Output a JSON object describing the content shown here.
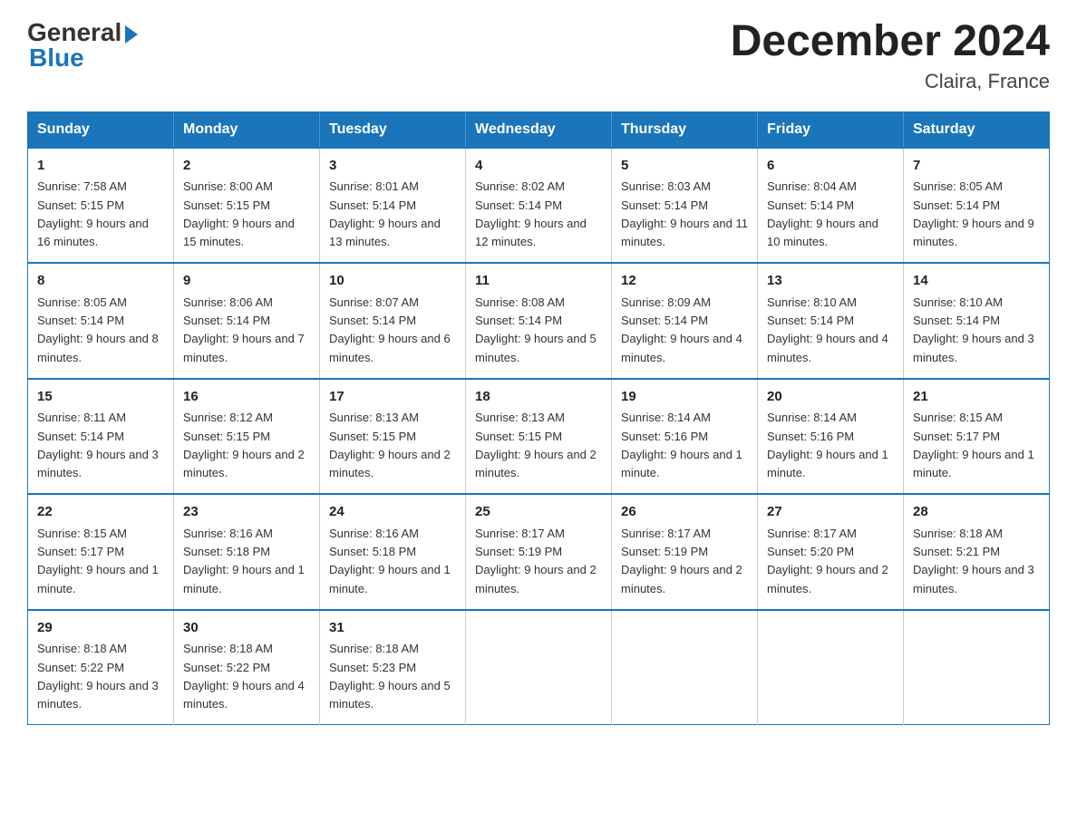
{
  "header": {
    "logo_general": "General",
    "logo_blue": "Blue",
    "month_year": "December 2024",
    "location": "Claira, France"
  },
  "days_of_week": [
    "Sunday",
    "Monday",
    "Tuesday",
    "Wednesday",
    "Thursday",
    "Friday",
    "Saturday"
  ],
  "weeks": [
    [
      {
        "num": "1",
        "sunrise": "7:58 AM",
        "sunset": "5:15 PM",
        "daylight": "9 hours and 16 minutes."
      },
      {
        "num": "2",
        "sunrise": "8:00 AM",
        "sunset": "5:15 PM",
        "daylight": "9 hours and 15 minutes."
      },
      {
        "num": "3",
        "sunrise": "8:01 AM",
        "sunset": "5:14 PM",
        "daylight": "9 hours and 13 minutes."
      },
      {
        "num": "4",
        "sunrise": "8:02 AM",
        "sunset": "5:14 PM",
        "daylight": "9 hours and 12 minutes."
      },
      {
        "num": "5",
        "sunrise": "8:03 AM",
        "sunset": "5:14 PM",
        "daylight": "9 hours and 11 minutes."
      },
      {
        "num": "6",
        "sunrise": "8:04 AM",
        "sunset": "5:14 PM",
        "daylight": "9 hours and 10 minutes."
      },
      {
        "num": "7",
        "sunrise": "8:05 AM",
        "sunset": "5:14 PM",
        "daylight": "9 hours and 9 minutes."
      }
    ],
    [
      {
        "num": "8",
        "sunrise": "8:05 AM",
        "sunset": "5:14 PM",
        "daylight": "9 hours and 8 minutes."
      },
      {
        "num": "9",
        "sunrise": "8:06 AM",
        "sunset": "5:14 PM",
        "daylight": "9 hours and 7 minutes."
      },
      {
        "num": "10",
        "sunrise": "8:07 AM",
        "sunset": "5:14 PM",
        "daylight": "9 hours and 6 minutes."
      },
      {
        "num": "11",
        "sunrise": "8:08 AM",
        "sunset": "5:14 PM",
        "daylight": "9 hours and 5 minutes."
      },
      {
        "num": "12",
        "sunrise": "8:09 AM",
        "sunset": "5:14 PM",
        "daylight": "9 hours and 4 minutes."
      },
      {
        "num": "13",
        "sunrise": "8:10 AM",
        "sunset": "5:14 PM",
        "daylight": "9 hours and 4 minutes."
      },
      {
        "num": "14",
        "sunrise": "8:10 AM",
        "sunset": "5:14 PM",
        "daylight": "9 hours and 3 minutes."
      }
    ],
    [
      {
        "num": "15",
        "sunrise": "8:11 AM",
        "sunset": "5:14 PM",
        "daylight": "9 hours and 3 minutes."
      },
      {
        "num": "16",
        "sunrise": "8:12 AM",
        "sunset": "5:15 PM",
        "daylight": "9 hours and 2 minutes."
      },
      {
        "num": "17",
        "sunrise": "8:13 AM",
        "sunset": "5:15 PM",
        "daylight": "9 hours and 2 minutes."
      },
      {
        "num": "18",
        "sunrise": "8:13 AM",
        "sunset": "5:15 PM",
        "daylight": "9 hours and 2 minutes."
      },
      {
        "num": "19",
        "sunrise": "8:14 AM",
        "sunset": "5:16 PM",
        "daylight": "9 hours and 1 minute."
      },
      {
        "num": "20",
        "sunrise": "8:14 AM",
        "sunset": "5:16 PM",
        "daylight": "9 hours and 1 minute."
      },
      {
        "num": "21",
        "sunrise": "8:15 AM",
        "sunset": "5:17 PM",
        "daylight": "9 hours and 1 minute."
      }
    ],
    [
      {
        "num": "22",
        "sunrise": "8:15 AM",
        "sunset": "5:17 PM",
        "daylight": "9 hours and 1 minute."
      },
      {
        "num": "23",
        "sunrise": "8:16 AM",
        "sunset": "5:18 PM",
        "daylight": "9 hours and 1 minute."
      },
      {
        "num": "24",
        "sunrise": "8:16 AM",
        "sunset": "5:18 PM",
        "daylight": "9 hours and 1 minute."
      },
      {
        "num": "25",
        "sunrise": "8:17 AM",
        "sunset": "5:19 PM",
        "daylight": "9 hours and 2 minutes."
      },
      {
        "num": "26",
        "sunrise": "8:17 AM",
        "sunset": "5:19 PM",
        "daylight": "9 hours and 2 minutes."
      },
      {
        "num": "27",
        "sunrise": "8:17 AM",
        "sunset": "5:20 PM",
        "daylight": "9 hours and 2 minutes."
      },
      {
        "num": "28",
        "sunrise": "8:18 AM",
        "sunset": "5:21 PM",
        "daylight": "9 hours and 3 minutes."
      }
    ],
    [
      {
        "num": "29",
        "sunrise": "8:18 AM",
        "sunset": "5:22 PM",
        "daylight": "9 hours and 3 minutes."
      },
      {
        "num": "30",
        "sunrise": "8:18 AM",
        "sunset": "5:22 PM",
        "daylight": "9 hours and 4 minutes."
      },
      {
        "num": "31",
        "sunrise": "8:18 AM",
        "sunset": "5:23 PM",
        "daylight": "9 hours and 5 minutes."
      },
      null,
      null,
      null,
      null
    ]
  ]
}
